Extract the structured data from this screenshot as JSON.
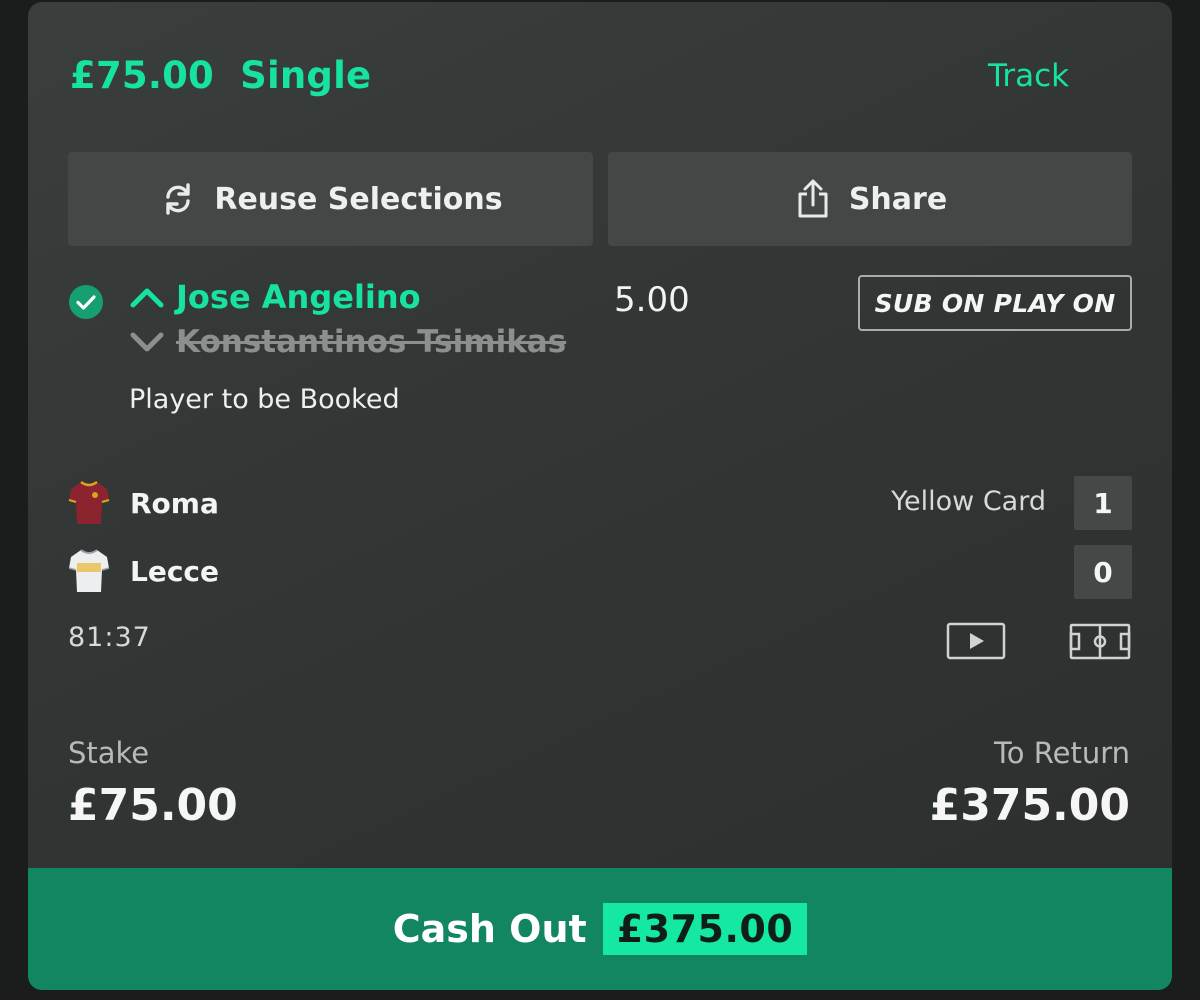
{
  "bet": {
    "header": "£75.00  Single",
    "track_label": "Track"
  },
  "actions": {
    "reuse_label": "Reuse Selections",
    "share_label": "Share"
  },
  "selection": {
    "player_on": "Jose Angelino",
    "player_off": "Konstantinos Tsimikas",
    "odds": "5.00",
    "badge": "SUB ON PLAY ON",
    "market": "Player to be Booked"
  },
  "match": {
    "home_team": "Roma",
    "away_team": "Lecce",
    "stat_label": "Yellow Card",
    "home_score": "1",
    "away_score": "0",
    "clock": "81:37"
  },
  "summary": {
    "stake_label": "Stake",
    "stake_value": "£75.00",
    "return_label": "To Return",
    "return_value": "£375.00"
  },
  "cashout": {
    "label": "Cash Out",
    "amount": "£375.00"
  },
  "colors": {
    "accent": "#16e3a1",
    "cashout_bg": "#128563",
    "card_bg": "#333735"
  },
  "icons": {
    "reuse": "refresh-icon",
    "share": "share-icon",
    "status": "check-circle-icon",
    "sub_on": "arrow-up-icon",
    "sub_off": "arrow-down-icon",
    "video": "play-video-icon",
    "pitch": "pitch-tracker-icon"
  }
}
